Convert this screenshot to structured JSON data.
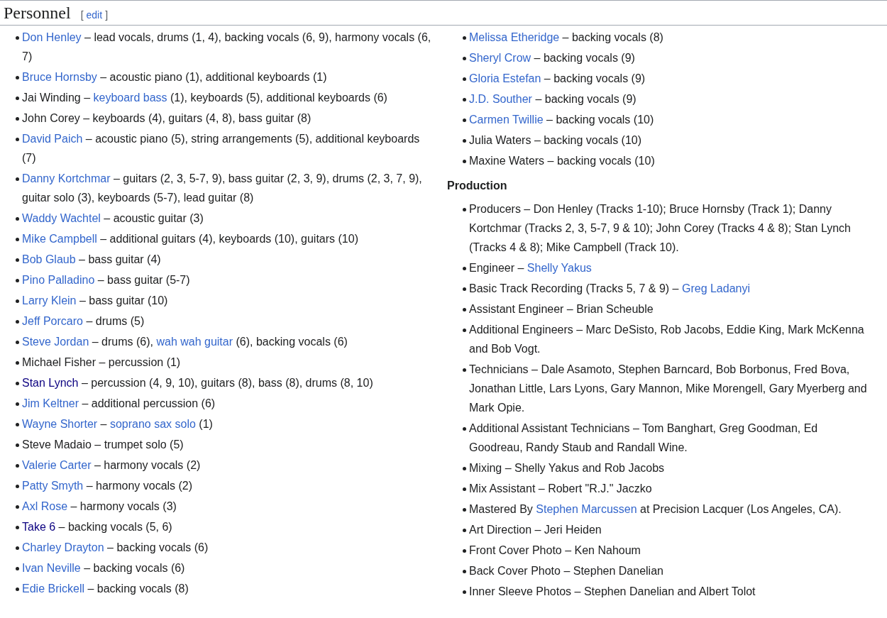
{
  "heading": {
    "title": "Personnel",
    "edit_open": "[",
    "edit_label": "edit",
    "edit_close": "]"
  },
  "left_list": [
    {
      "parts": [
        {
          "kind": "link",
          "text": "Don Henley"
        },
        {
          "kind": "plain",
          "text": " – lead vocals, drums (1, 4), backing vocals (6, 9), harmony vocals (6, 7)"
        }
      ]
    },
    {
      "parts": [
        {
          "kind": "link",
          "text": "Bruce Hornsby"
        },
        {
          "kind": "plain",
          "text": " – acoustic piano (1), additional keyboards (1)"
        }
      ]
    },
    {
      "parts": [
        {
          "kind": "plain",
          "text": "Jai Winding – "
        },
        {
          "kind": "link",
          "text": "keyboard bass"
        },
        {
          "kind": "plain",
          "text": " (1), keyboards (5), additional keyboards (6)"
        }
      ]
    },
    {
      "parts": [
        {
          "kind": "plain",
          "text": "John Corey – keyboards (4), guitars (4, 8), bass guitar (8)"
        }
      ]
    },
    {
      "parts": [
        {
          "kind": "link",
          "text": "David Paich"
        },
        {
          "kind": "plain",
          "text": " – acoustic piano (5), string arrangements (5), additional keyboards (7)"
        }
      ]
    },
    {
      "parts": [
        {
          "kind": "link",
          "text": "Danny Kortchmar"
        },
        {
          "kind": "plain",
          "text": " – guitars (2, 3, 5-7, 9), bass guitar (2, 3, 9), drums (2, 3, 7, 9), guitar solo (3), keyboards (5-7), lead guitar (8)"
        }
      ]
    },
    {
      "parts": [
        {
          "kind": "link",
          "text": "Waddy Wachtel"
        },
        {
          "kind": "plain",
          "text": " – acoustic guitar (3)"
        }
      ]
    },
    {
      "parts": [
        {
          "kind": "link",
          "text": "Mike Campbell"
        },
        {
          "kind": "plain",
          "text": " – additional guitars (4), keyboards (10), guitars (10)"
        }
      ]
    },
    {
      "parts": [
        {
          "kind": "link",
          "text": "Bob Glaub"
        },
        {
          "kind": "plain",
          "text": " – bass guitar (4)"
        }
      ]
    },
    {
      "parts": [
        {
          "kind": "link",
          "text": "Pino Palladino"
        },
        {
          "kind": "plain",
          "text": " – bass guitar (5-7)"
        }
      ]
    },
    {
      "parts": [
        {
          "kind": "link",
          "text": "Larry Klein"
        },
        {
          "kind": "plain",
          "text": " – bass guitar (10)"
        }
      ]
    },
    {
      "parts": [
        {
          "kind": "link",
          "text": "Jeff Porcaro"
        },
        {
          "kind": "plain",
          "text": " – drums (5)"
        }
      ]
    },
    {
      "parts": [
        {
          "kind": "link",
          "text": "Steve Jordan"
        },
        {
          "kind": "plain",
          "text": " – drums (6), "
        },
        {
          "kind": "link",
          "text": "wah wah guitar"
        },
        {
          "kind": "plain",
          "text": " (6), backing vocals (6)"
        }
      ]
    },
    {
      "parts": [
        {
          "kind": "plain",
          "text": "Michael Fisher – percussion (1)"
        }
      ]
    },
    {
      "parts": [
        {
          "kind": "visited_link",
          "text": "Stan Lynch"
        },
        {
          "kind": "plain",
          "text": " – percussion (4, 9, 10), guitars (8), bass (8), drums (8, 10)"
        }
      ]
    },
    {
      "parts": [
        {
          "kind": "link",
          "text": "Jim Keltner"
        },
        {
          "kind": "plain",
          "text": " – additional percussion (6)"
        }
      ]
    },
    {
      "parts": [
        {
          "kind": "link",
          "text": "Wayne Shorter"
        },
        {
          "kind": "plain",
          "text": " – "
        },
        {
          "kind": "link",
          "text": "soprano sax solo"
        },
        {
          "kind": "plain",
          "text": " (1)"
        }
      ]
    },
    {
      "parts": [
        {
          "kind": "plain",
          "text": "Steve Madaio – trumpet solo (5)"
        }
      ]
    },
    {
      "parts": [
        {
          "kind": "link",
          "text": "Valerie Carter"
        },
        {
          "kind": "plain",
          "text": " – harmony vocals (2)"
        }
      ]
    },
    {
      "parts": [
        {
          "kind": "link",
          "text": "Patty Smyth"
        },
        {
          "kind": "plain",
          "text": " – harmony vocals (2)"
        }
      ]
    },
    {
      "parts": [
        {
          "kind": "link",
          "text": "Axl Rose"
        },
        {
          "kind": "plain",
          "text": " – harmony vocals (3)"
        }
      ]
    },
    {
      "parts": [
        {
          "kind": "visited_link",
          "text": "Take 6"
        },
        {
          "kind": "plain",
          "text": " – backing vocals (5, 6)"
        }
      ]
    },
    {
      "parts": [
        {
          "kind": "link",
          "text": "Charley Drayton"
        },
        {
          "kind": "plain",
          "text": " – backing vocals (6)"
        }
      ]
    },
    {
      "parts": [
        {
          "kind": "link",
          "text": "Ivan Neville"
        },
        {
          "kind": "plain",
          "text": " – backing vocals (6)"
        }
      ]
    },
    {
      "parts": [
        {
          "kind": "link",
          "text": "Edie Brickell"
        },
        {
          "kind": "plain",
          "text": " – backing vocals (8)"
        }
      ]
    }
  ],
  "right_list": [
    {
      "parts": [
        {
          "kind": "link",
          "text": "Melissa Etheridge"
        },
        {
          "kind": "plain",
          "text": " – backing vocals (8)"
        }
      ]
    },
    {
      "parts": [
        {
          "kind": "link",
          "text": "Sheryl Crow"
        },
        {
          "kind": "plain",
          "text": " – backing vocals (9)"
        }
      ]
    },
    {
      "parts": [
        {
          "kind": "link",
          "text": "Gloria Estefan"
        },
        {
          "kind": "plain",
          "text": " – backing vocals (9)"
        }
      ]
    },
    {
      "parts": [
        {
          "kind": "link",
          "text": "J.D. Souther"
        },
        {
          "kind": "plain",
          "text": " – backing vocals (9)"
        }
      ]
    },
    {
      "parts": [
        {
          "kind": "link",
          "text": "Carmen Twillie"
        },
        {
          "kind": "plain",
          "text": " – backing vocals (10)"
        }
      ]
    },
    {
      "parts": [
        {
          "kind": "plain",
          "text": "Julia Waters – backing vocals (10)"
        }
      ]
    },
    {
      "parts": [
        {
          "kind": "plain",
          "text": "Maxine Waters – backing vocals (10)"
        }
      ]
    }
  ],
  "production": {
    "title": "Production",
    "items": [
      {
        "parts": [
          {
            "kind": "plain",
            "text": "Producers – Don Henley (Tracks 1-10); Bruce Hornsby (Track 1); Danny Kortchmar (Tracks 2, 3, 5-7, 9 & 10); John Corey (Tracks 4 & 8); Stan Lynch (Tracks 4 & 8); Mike Campbell (Track 10)."
          }
        ]
      },
      {
        "parts": [
          {
            "kind": "plain",
            "text": "Engineer – "
          },
          {
            "kind": "link",
            "text": "Shelly Yakus"
          }
        ]
      },
      {
        "parts": [
          {
            "kind": "plain",
            "text": "Basic Track Recording (Tracks 5, 7 & 9) – "
          },
          {
            "kind": "link",
            "text": "Greg Ladanyi"
          }
        ]
      },
      {
        "parts": [
          {
            "kind": "plain",
            "text": "Assistant Engineer – Brian Scheuble"
          }
        ]
      },
      {
        "parts": [
          {
            "kind": "plain",
            "text": "Additional Engineers – Marc DeSisto, Rob Jacobs, Eddie King, Mark McKenna and Bob Vogt."
          }
        ]
      },
      {
        "parts": [
          {
            "kind": "plain",
            "text": "Technicians – Dale Asamoto, Stephen Barncard, Bob Borbonus, Fred Bova, Jonathan Little, Lars Lyons, Gary Mannon, Mike Morengell, Gary Myerberg and Mark Opie."
          }
        ]
      },
      {
        "parts": [
          {
            "kind": "plain",
            "text": "Additional Assistant Technicians – Tom Banghart, Greg Goodman, Ed Goodreau, Randy Staub and Randall Wine."
          }
        ]
      },
      {
        "parts": [
          {
            "kind": "plain",
            "text": "Mixing – Shelly Yakus and Rob Jacobs"
          }
        ]
      },
      {
        "parts": [
          {
            "kind": "plain",
            "text": "Mix Assistant – Robert \"R.J.\" Jaczko"
          }
        ]
      },
      {
        "parts": [
          {
            "kind": "plain",
            "text": "Mastered By "
          },
          {
            "kind": "link",
            "text": "Stephen Marcussen"
          },
          {
            "kind": "plain",
            "text": " at Precision Lacquer (Los Angeles, CA)."
          }
        ]
      },
      {
        "parts": [
          {
            "kind": "plain",
            "text": "Art Direction – Jeri Heiden"
          }
        ]
      },
      {
        "parts": [
          {
            "kind": "plain",
            "text": "Front Cover Photo – Ken Nahoum"
          }
        ]
      },
      {
        "parts": [
          {
            "kind": "plain",
            "text": "Back Cover Photo – Stephen Danelian"
          }
        ]
      },
      {
        "parts": [
          {
            "kind": "plain",
            "text": "Inner Sleeve Photos – Stephen Danelian and Albert Tolot"
          }
        ]
      }
    ]
  }
}
